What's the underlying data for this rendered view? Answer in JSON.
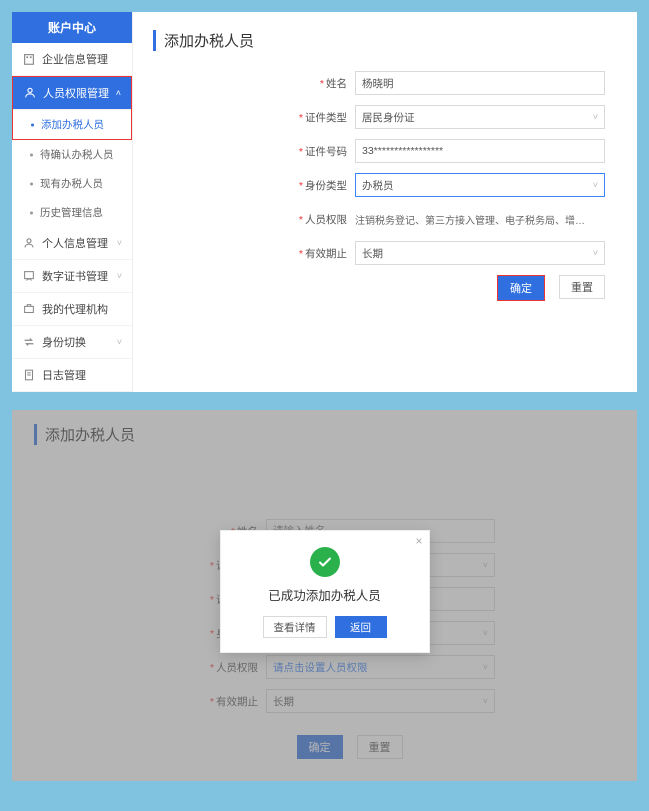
{
  "sidebar": {
    "header": "账户中心",
    "menu": [
      {
        "label": "企业信息管理",
        "chev": ""
      },
      {
        "label": "人员权限管理",
        "chev": "˄"
      },
      {
        "label": "个人信息管理",
        "chev": "˅"
      },
      {
        "label": "数字证书管理",
        "chev": "˅"
      },
      {
        "label": "我的代理机构",
        "chev": ""
      },
      {
        "label": "身份切换",
        "chev": "˅"
      },
      {
        "label": "日志管理",
        "chev": ""
      }
    ],
    "submenu": [
      {
        "label": "添加办税人员"
      },
      {
        "label": "待确认办税人员"
      },
      {
        "label": "现有办税人员"
      },
      {
        "label": "历史管理信息"
      }
    ]
  },
  "top": {
    "title": "添加办税人员",
    "fields": {
      "name_label": "姓名",
      "name_value": "杨晓明",
      "id_type_label": "证件类型",
      "id_type_value": "居民身份证",
      "id_no_label": "证件号码",
      "id_no_value": "33*****************",
      "role_label": "身份类型",
      "role_value": "办税员",
      "perm_label": "人员权限",
      "perm_value": "注销税务登记、第三方接入管理、电子税务局、增…",
      "valid_label": "有效期止",
      "valid_value": "长期"
    },
    "actions": {
      "confirm": "确定",
      "reset": "重置"
    }
  },
  "bottom": {
    "title": "添加办税人员",
    "fields": {
      "name_label": "姓名",
      "name_placeholder": "请输入姓名",
      "id_type_label": "证件类型",
      "id_no_label": "证件号码",
      "role_label": "身份类型",
      "perm_label": "人员权限",
      "perm_placeholder": "请点击设置人员权限",
      "valid_label": "有效期止",
      "valid_value": "长期"
    },
    "actions": {
      "confirm": "确定",
      "reset": "重置"
    },
    "modal": {
      "message": "已成功添加办税人员",
      "view": "查看详情",
      "back": "返回"
    }
  }
}
